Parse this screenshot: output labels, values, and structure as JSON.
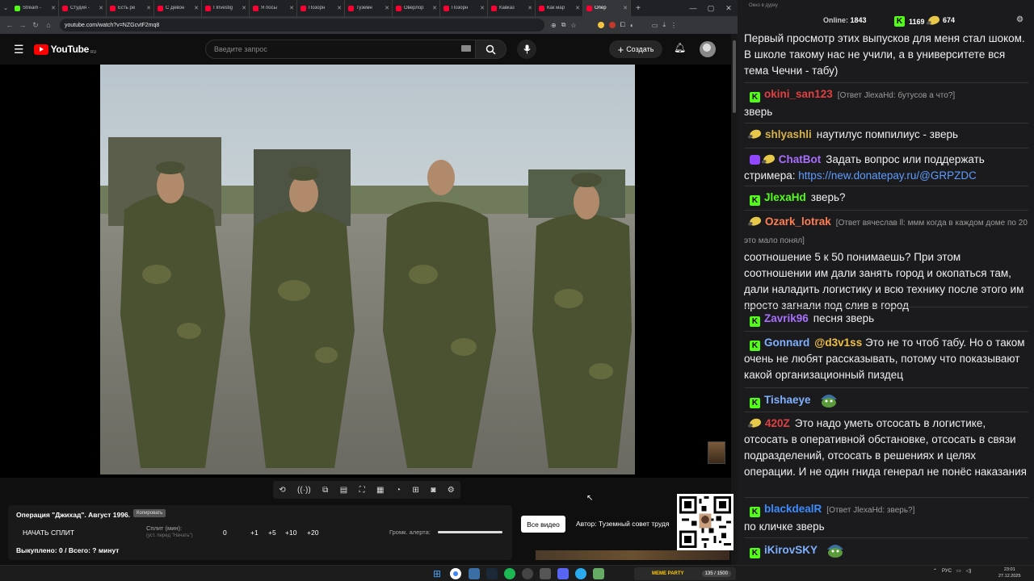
{
  "browser": {
    "tabs": [
      {
        "title": "Stream -",
        "color": "#53fc18"
      },
      {
        "title": "Студия -",
        "color": "#ff0033"
      },
      {
        "title": "Есть ре",
        "color": "#ff0033"
      },
      {
        "title": "С Девон",
        "color": "#ff0033"
      },
      {
        "title": "I Investig",
        "color": "#ff0033"
      },
      {
        "title": "Я посы",
        "color": "#ff0033"
      },
      {
        "title": "Позорн",
        "color": "#ff0033"
      },
      {
        "title": "Туземн",
        "color": "#ff0033"
      },
      {
        "title": "Оверлор",
        "color": "#ff0033"
      },
      {
        "title": "Позорн",
        "color": "#ff0033"
      },
      {
        "title": "Кавказ",
        "color": "#ff0033"
      },
      {
        "title": "Как мар",
        "color": "#ff0033"
      },
      {
        "title": "Опер",
        "color": "#ff0033"
      }
    ],
    "url": "youtube.com/watch?v=NZGcvtF2mq8"
  },
  "youtube": {
    "logo_text": "YouTube",
    "region": "RU",
    "search_placeholder": "Введите запрос",
    "create_label": "Создать"
  },
  "panel": {
    "title": "Операция \"Джихад\". Август 1996.",
    "copy_label": "Копировать",
    "start_split": "НАЧАТЬ СПЛИТ",
    "split_label": "Сплит (мин):",
    "split_hint": "(уст. перед \"Начать\")",
    "split_values": [
      "0",
      "+1",
      "+5",
      "+10",
      "+20"
    ],
    "volume_label": "Громк. алерта:",
    "volume_level": 1.0,
    "bought": "Выкуплено: 0 / Всего: ? минут",
    "all_videos": "Все видео",
    "author": "Автор: Туземный совет трудя"
  },
  "chat": {
    "window_title": "Окно в дурку",
    "online_label": "Online:",
    "online_count": "1843",
    "stat_k": "1169",
    "stat_b": "674",
    "messages": [
      {
        "user": "",
        "color": "",
        "icon": "",
        "reply": "",
        "text": "Первый просмотр этих выпусков для меня стал шоком. В школе такому нас не учили, а в университете вся тема Чечни - табу)"
      },
      {
        "user": "okini_san123",
        "color": "#e04040",
        "icon": "kick",
        "reply": "[Ответ JlexaHd: бутусов а что?]",
        "text": "зверь"
      },
      {
        "user": "shlyashli",
        "color": "#d6b24a",
        "icon": "bb",
        "reply": "",
        "text": "наутилус помпилиус - зверь"
      },
      {
        "user": "ChatBot",
        "color": "#a970ff",
        "icon": "bot",
        "reply": "",
        "text": "Задать вопрос или поддержать стримера: ",
        "link": "https://new.donatepay.ru/@GRPZDC"
      },
      {
        "user": "JlexaHd",
        "color": "#53fc18",
        "icon": "kick",
        "reply": "",
        "text": "зверь?"
      },
      {
        "user": "Ozark_lotrak",
        "color": "#ff7f50",
        "icon": "bb",
        "reply": "[Ответ вячеслав ll: ммм когда в каждом доме по 20 это мало  понял]",
        "text": "соотношение 5 к 50 понимаешь? При этом соотношении им дали занять город и окопаться там, дали наладить логистику и всю технику после этого им просто загнали под слив в город"
      },
      {
        "user": "Zavrik96",
        "color": "#a970ff",
        "icon": "kick",
        "reply": "",
        "text": "песня зверь"
      },
      {
        "user": "Gonnard",
        "color": "#7fb0ff",
        "icon": "kick",
        "reply": "",
        "mention": "@d3v1ss",
        "text": "Это не то чтоб табу. Но о таком очень не любят рассказывать, потому что показывают какой организационный пиздец"
      },
      {
        "user": "Tishaeye",
        "color": "#7fb0ff",
        "icon": "kick",
        "reply": "",
        "text": ""
      },
      {
        "user": "420Z",
        "color": "#e04040",
        "icon": "bb",
        "reply": "",
        "text": "Это надо уметь отсосать в логистике, отсосать в оперативной обстановке, отсосать в связи подразделений, отсосать в решениях и целях операции. И не один гнида генерал не понёс наказания"
      },
      {
        "user": "blackdealR",
        "color": "#3c8cff",
        "icon": "kick",
        "reply": "[Ответ JlexaHd: зверь?]",
        "text": "по кличке зверь"
      },
      {
        "user": "iKirovSKY",
        "color": "#7fb0ff",
        "icon": "kick",
        "reply": "",
        "text": ""
      }
    ]
  },
  "taskbar": {
    "meme_party_label": "MEME PARTY",
    "meme_party_count": "135 / 1500",
    "lang": "РУС",
    "time": "23:01",
    "date": "27.12.2025"
  }
}
